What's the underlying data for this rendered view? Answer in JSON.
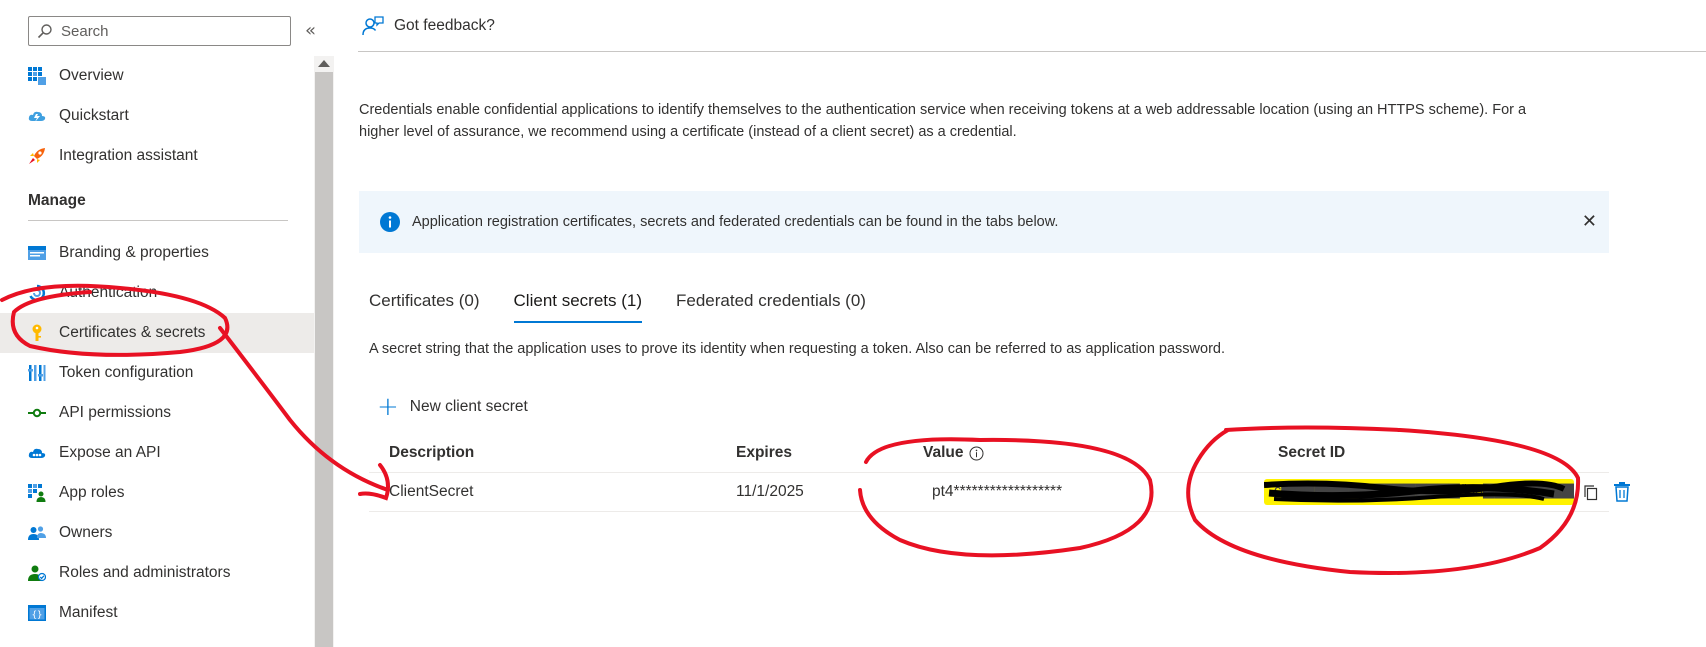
{
  "sidebar": {
    "search": {
      "placeholder": "Search"
    },
    "items": [
      {
        "label": "Overview",
        "icon": "grid-icon"
      },
      {
        "label": "Quickstart",
        "icon": "cloud-bolt-icon"
      },
      {
        "label": "Integration assistant",
        "icon": "rocket-icon"
      }
    ],
    "manage_title": "Manage",
    "manage_items": [
      {
        "label": "Branding & properties",
        "icon": "branding-icon"
      },
      {
        "label": "Authentication",
        "icon": "authentication-icon"
      },
      {
        "label": "Certificates & secrets",
        "icon": "key-icon",
        "active": true
      },
      {
        "label": "Token configuration",
        "icon": "token-bars-icon"
      },
      {
        "label": "API permissions",
        "icon": "api-arrow-icon"
      },
      {
        "label": "Expose an API",
        "icon": "cloud-api-icon"
      },
      {
        "label": "App roles",
        "icon": "app-roles-icon"
      },
      {
        "label": "Owners",
        "icon": "people-icon"
      },
      {
        "label": "Roles and administrators",
        "icon": "user-check-icon"
      },
      {
        "label": "Manifest",
        "icon": "manifest-icon"
      }
    ]
  },
  "main": {
    "feedback": "Got feedback?",
    "intro": "Credentials enable confidential applications to identify themselves to the authentication service when receiving tokens at a web addressable location (using an HTTPS scheme). For a higher level of assurance, we recommend using a certificate (instead of a client secret) as a credential.",
    "banner": "Application registration certificates, secrets and federated credentials can be found in the tabs below.",
    "tabs": [
      {
        "label": "Certificates (0)"
      },
      {
        "label": "Client secrets (1)",
        "active": true
      },
      {
        "label": "Federated credentials (0)"
      }
    ],
    "tab_description": "A secret string that the application uses to prove its identity when requesting a token. Also can be referred to as application password.",
    "new_secret_label": "New client secret",
    "table": {
      "headers": {
        "description": "Description",
        "expires": "Expires",
        "value": "Value",
        "secret_id": "Secret ID"
      },
      "rows": [
        {
          "description": "ClientSecret",
          "expires": "11/1/2025",
          "value": "pt4******************",
          "secret_id": "c▇▇▇▇▇▇▇▇▇▇▇▇▇▇▇▇/l30▇▇▇▇▇▇▇▇▇▇▇▇▇▇▇▇▇9"
        }
      ]
    }
  },
  "colors": {
    "accent": "#0078d4",
    "banner_bg": "#eff6fc",
    "annotation_red": "#e81123",
    "highlight_yellow": "#fff200"
  }
}
